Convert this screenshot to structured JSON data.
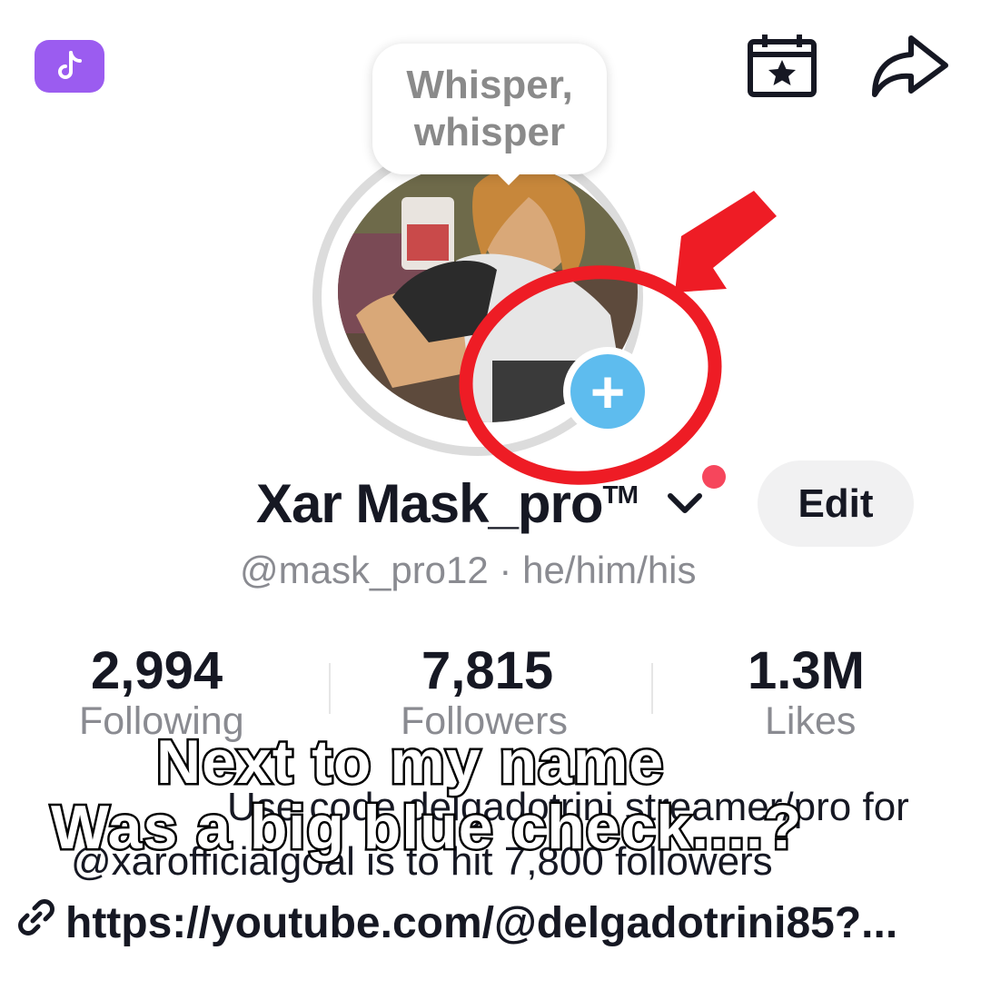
{
  "note": {
    "text": "Whisper, whisper"
  },
  "profile": {
    "display_name": "Xar Mask_pro",
    "name_suffix": "TM",
    "handle_line": "@mask_pro12 · he/him/his",
    "edit_label": "Edit"
  },
  "stats": [
    {
      "value": "2,994",
      "label": "Following"
    },
    {
      "value": "7,815",
      "label": "Followers"
    },
    {
      "value": "1.3M",
      "label": "Likes"
    }
  ],
  "bio": {
    "line1": "Use code delgadotrini streamer/pro for",
    "line2": "@xarofficialgoal is to hit 7,800 followers",
    "link": "https://youtube.com/@delgadotrini85?..."
  },
  "caption": {
    "line1": "Next to my name",
    "line2": "Was a big blue check....?"
  },
  "icons": {
    "app_badge": "tiktok-icon",
    "calendar": "calendar-star-icon",
    "share": "share-arrow-icon",
    "add": "plus-icon",
    "dropdown": "chevron-down-icon",
    "link": "link-icon"
  },
  "colors": {
    "badge_purple": "#9b5cf0",
    "add_blue": "#5ebcee",
    "annotation_red": "#ee1c25",
    "notification_red": "#f6465c"
  }
}
